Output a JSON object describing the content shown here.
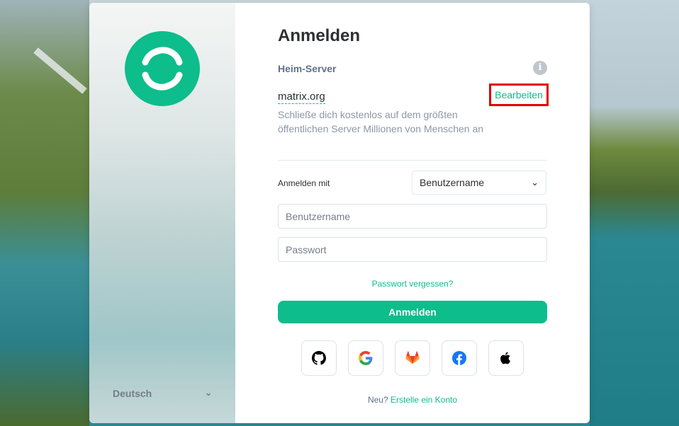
{
  "login": {
    "title": "Anmelden",
    "homeserver_label": "Heim-Server",
    "server_name": "matrix.org",
    "edit_label": "Bearbeiten",
    "server_description": "Schließe dich kostenlos auf dem größten öffentlichen Server Millionen von Menschen an",
    "login_with_label": "Anmelden mit",
    "login_with_selected": "Benutzername",
    "username_placeholder": "Benutzername",
    "password_placeholder": "Passwort",
    "forgot_password": "Passwort vergessen?",
    "submit_label": "Anmelden",
    "sso_providers": [
      "github-icon",
      "google-icon",
      "gitlab-icon",
      "facebook-icon",
      "apple-icon"
    ],
    "footer_prefix": "Neu?",
    "footer_link": "Erstelle ein Konto"
  },
  "sidebar": {
    "language": "Deutsch"
  },
  "colors": {
    "accent": "#0dbd8b",
    "highlight_box": "#e00000"
  }
}
